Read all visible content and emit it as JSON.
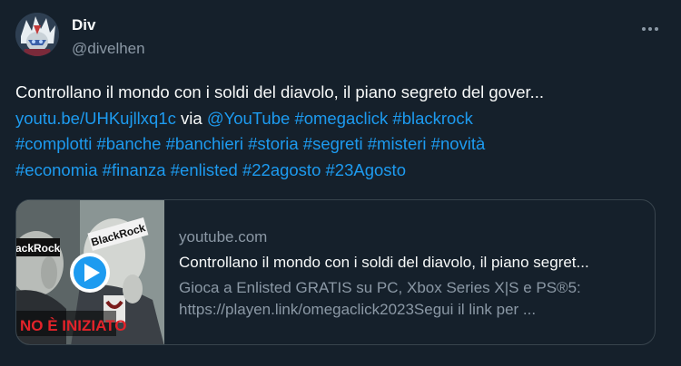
{
  "user": {
    "name": "Div",
    "handle": "@divelhen"
  },
  "tweet": {
    "line1": "Controllano il mondo con i soldi del diavolo, il piano segreto del gover...",
    "link": "youtu.be/UHKujllxq1c",
    "via": " via ",
    "mention": "@YouTube",
    "hashtags": [
      "#omegaclick",
      "#blackrock",
      "#complotti",
      "#banche",
      "#banchieri",
      "#storia",
      "#segreti",
      "#misteri",
      "#novità",
      "#economia",
      "#finanza",
      "#enlisted",
      "#22agosto",
      "#23Agosto"
    ]
  },
  "card": {
    "domain": "youtube.com",
    "title": "Controllano il mondo con i soldi del diavolo, il piano segret...",
    "description": "Gioca a Enlisted GRATIS su PC, Xbox Series X|S e PS®5: https://playen.link/omegaclick2023Segui il link per ...",
    "thumb_label_left": "lackRock",
    "thumb_label_right": "BlackRock",
    "thumb_banner": "NO È INIZIATO"
  },
  "colors": {
    "background": "#15202b",
    "accent": "#1d9bf0",
    "secondary_text": "#8b98a5",
    "border": "#38444d"
  }
}
